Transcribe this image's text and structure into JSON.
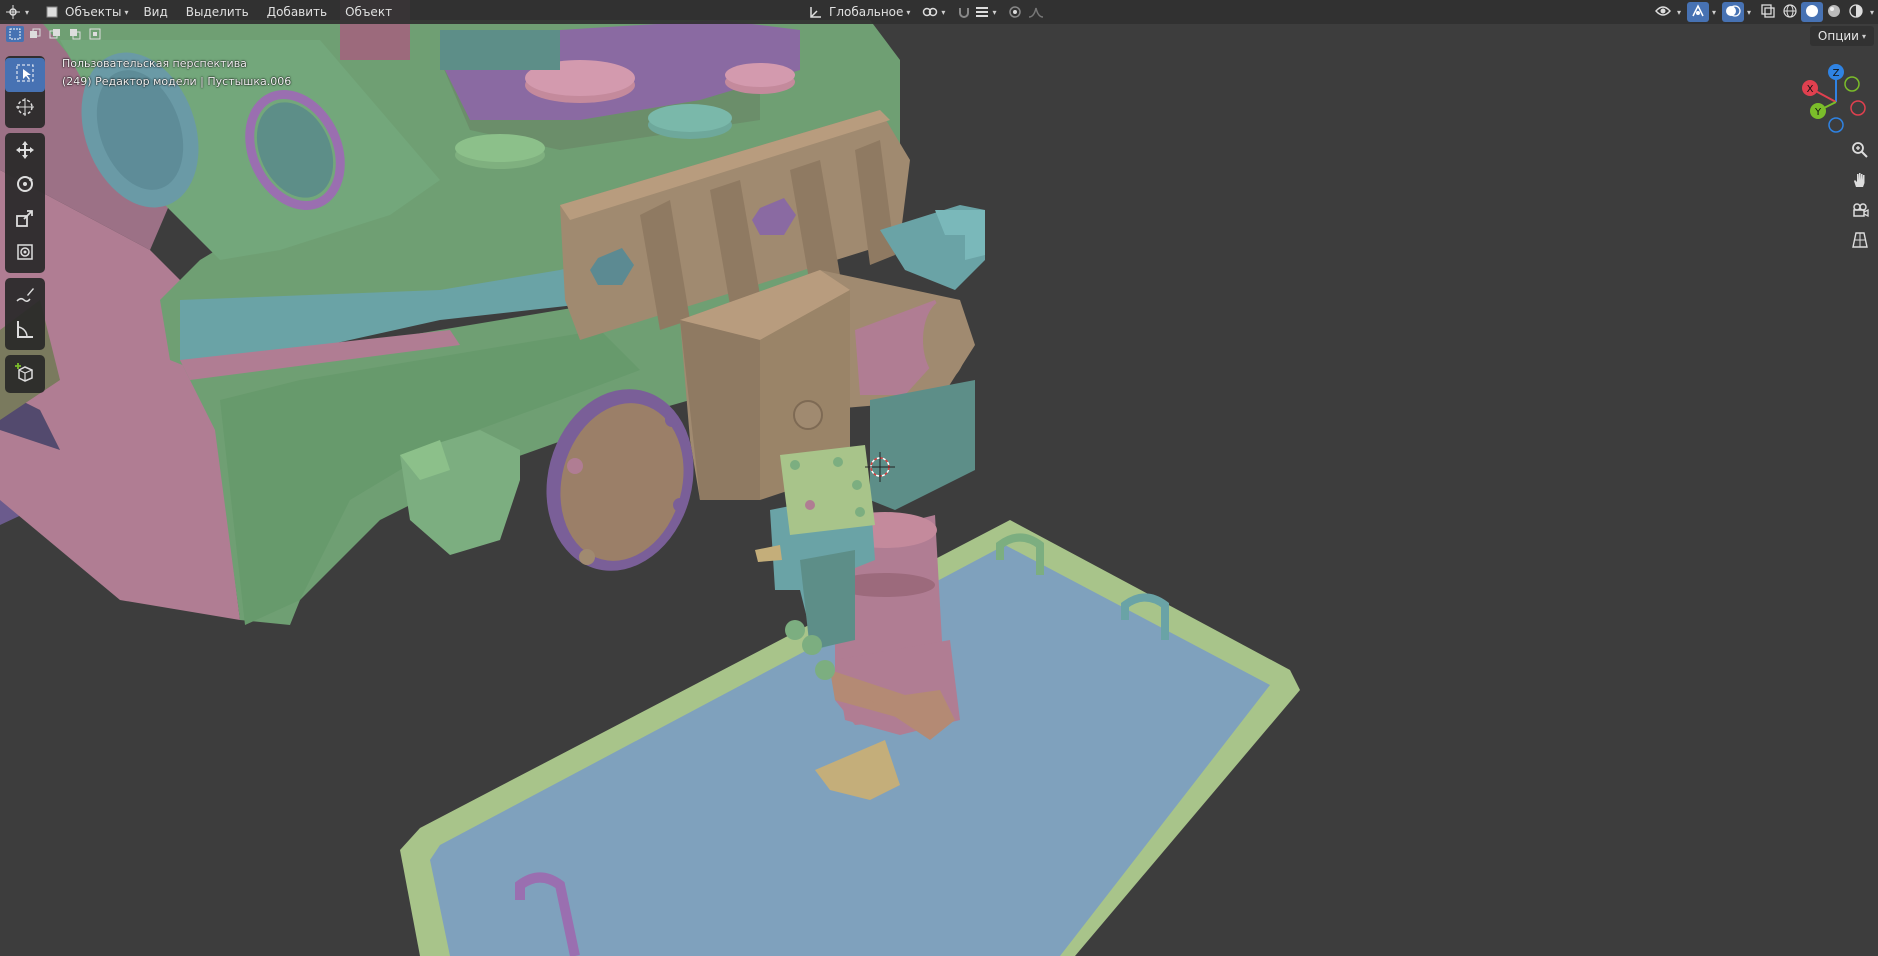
{
  "header": {
    "editor_icon": "3d-viewport-icon",
    "mode_label": "Объекты",
    "menus": [
      "Вид",
      "Выделить",
      "Добавить",
      "Объект"
    ],
    "orientation_label": "Глобальное",
    "options_label": "Опции"
  },
  "overlay": {
    "view_name": "Пользовательская перспектива",
    "object_info": "(249) Редактор модели | Пустышка.006"
  },
  "gizmo": {
    "x_label": "X",
    "y_label": "Y",
    "z_label": "Z",
    "colors": {
      "x": "#e0404f",
      "y": "#7bbd2a",
      "z": "#2f83e3"
    }
  },
  "toolbar": {
    "tools": [
      "select-box-icon",
      "cursor-icon",
      "move-icon",
      "rotate-icon",
      "scale-icon",
      "transform-icon",
      "annotate-icon",
      "measure-icon",
      "add-cube-icon"
    ],
    "active_tool": "select-box-icon"
  },
  "navigation": [
    "zoom-icon",
    "pan-hand-icon",
    "camera-view-icon",
    "ortho-grid-icon"
  ],
  "colors": {
    "accent": "#4772b3",
    "background": "#3d3d3d",
    "mesh_green": "#6e9e74",
    "mesh_pink": "#b97a97",
    "mesh_teal": "#6aa3a6",
    "mesh_tan": "#a08a70",
    "mesh_blue": "#7fa1bd",
    "mesh_purple": "#8a6aa2"
  }
}
